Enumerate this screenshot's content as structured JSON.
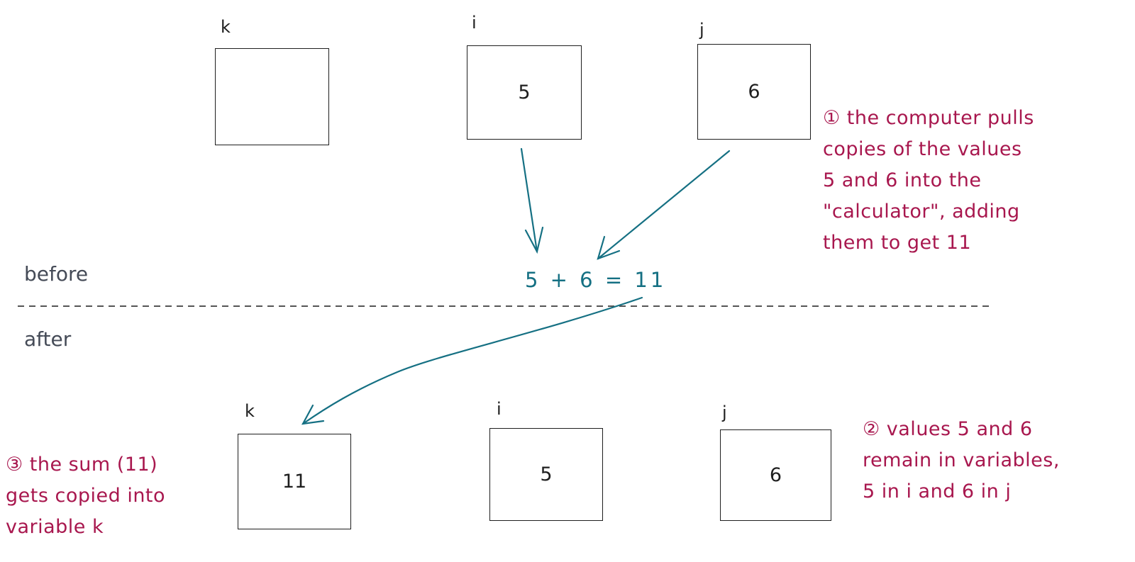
{
  "colors": {
    "arrow": "#157083",
    "annotation": "#a8174e",
    "phase": "#454b57",
    "box": "#1e1e1e"
  },
  "before": {
    "label": "before",
    "variables": [
      {
        "name": "k",
        "value": ""
      },
      {
        "name": "i",
        "value": "5"
      },
      {
        "name": "j",
        "value": "6"
      }
    ]
  },
  "after": {
    "label": "after",
    "variables": [
      {
        "name": "k",
        "value": "11"
      },
      {
        "name": "i",
        "value": "5"
      },
      {
        "name": "j",
        "value": "6"
      }
    ]
  },
  "equation": "5 + 6 = 11",
  "notes": {
    "n1": [
      "① the computer pulls",
      "copies of the values",
      "5 and 6 into the",
      "\"calculator\", adding",
      "them to get 11"
    ],
    "n2": [
      "② values 5 and 6",
      "remain in variables,",
      "5 in i and 6 in j"
    ],
    "n3": [
      "③ the sum (11)",
      "gets copied into",
      "variable k"
    ]
  }
}
